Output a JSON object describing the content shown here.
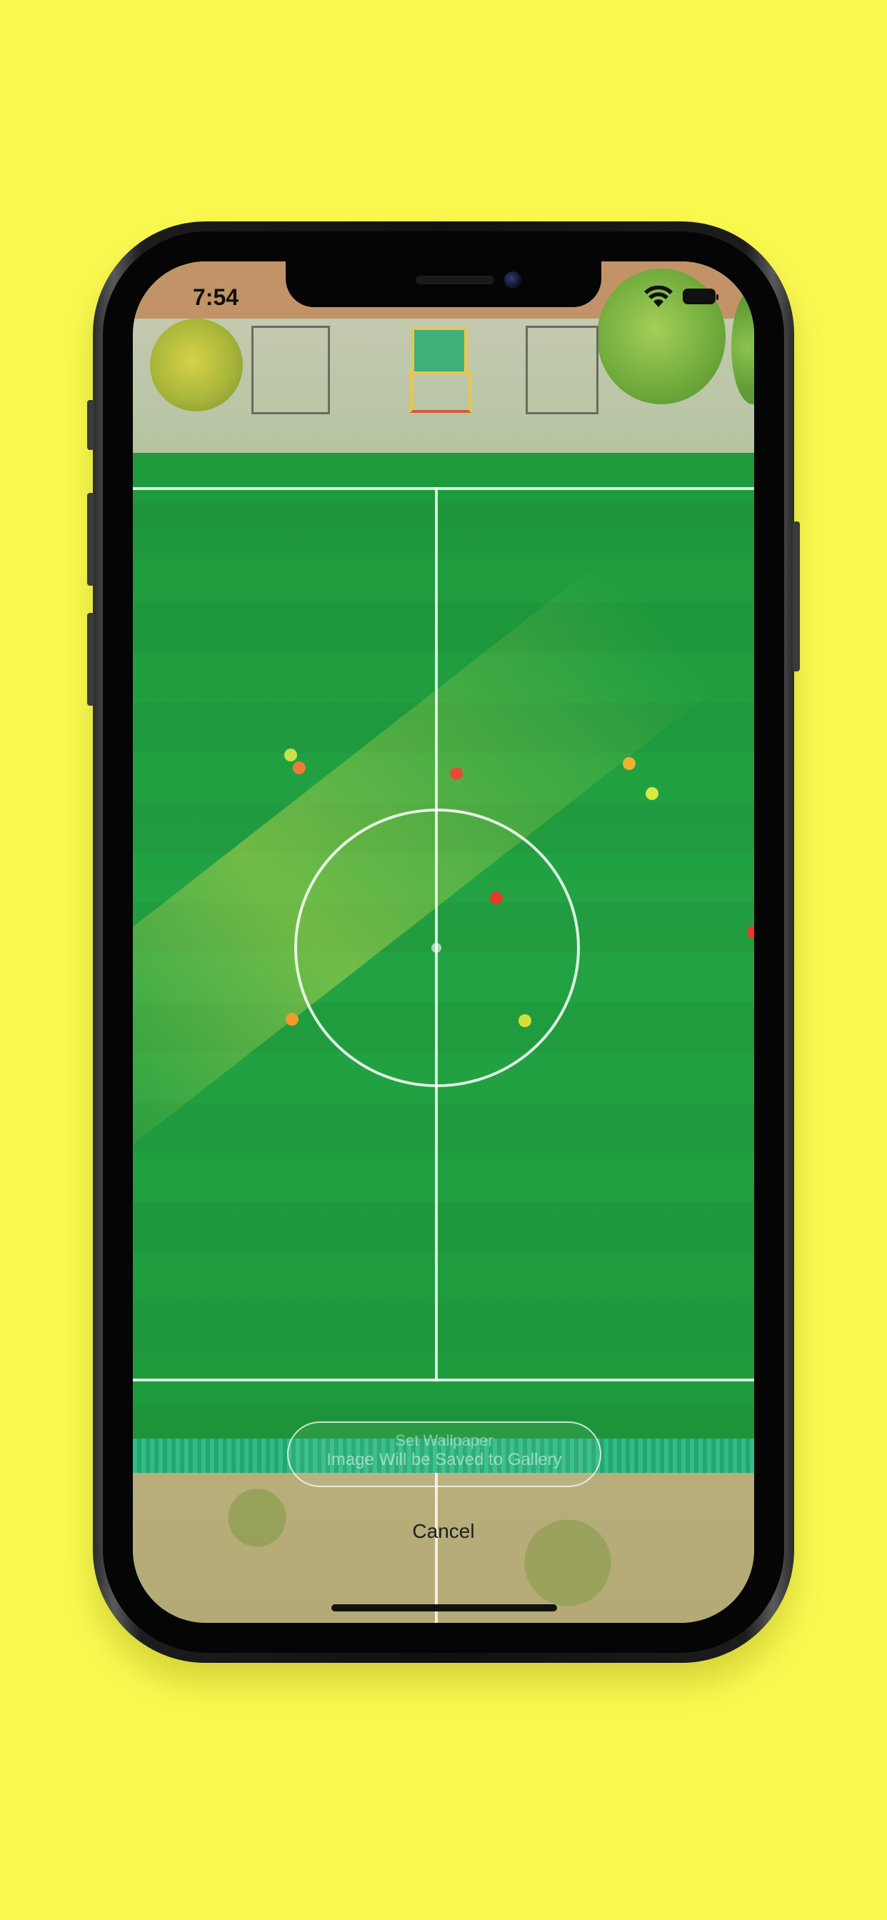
{
  "status_bar": {
    "time": "7:54",
    "wifi_icon": "wifi-icon",
    "battery_icon": "battery-full-icon"
  },
  "overlay": {
    "save_title": "Set Wallpaper",
    "save_subtitle": "Image Will be Saved to Gallery",
    "cancel_label": "Cancel"
  },
  "colors": {
    "background": "#f8f84f",
    "pitch_green": "#1f9b3b",
    "line_white": "#ffffff"
  }
}
